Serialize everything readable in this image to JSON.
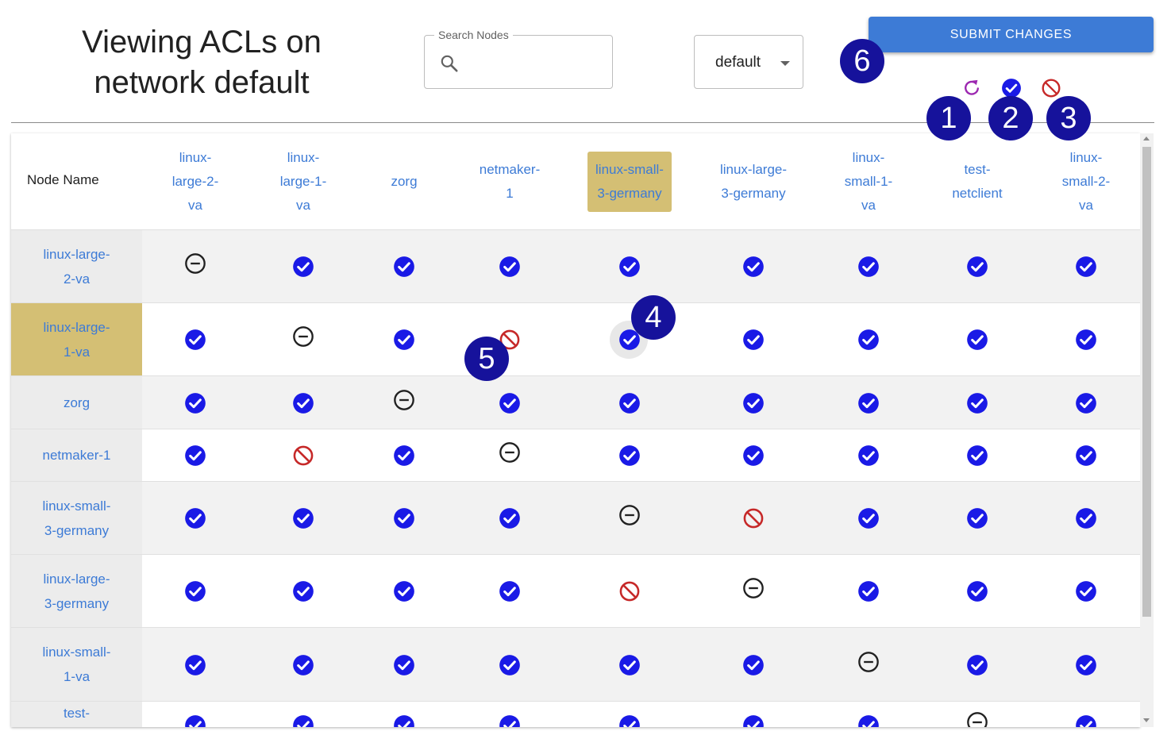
{
  "header": {
    "title_line1": "Viewing ACLs on",
    "title_line2": "network default",
    "search_label": "Search Nodes",
    "search_value": "",
    "network_select": "default",
    "submit_label": "SUBMIT CHANGES"
  },
  "legend": [
    {
      "icon": "reset-icon",
      "color": "#9c27b0"
    },
    {
      "icon": "check-circle-icon",
      "color": "#1a1ae6"
    },
    {
      "icon": "block-icon",
      "color": "#c62828"
    }
  ],
  "table": {
    "node_name_header": "Node Name",
    "columns": [
      "linux-\nlarge-2-\nva",
      "linux-\nlarge-1-\nva",
      "zorg",
      "netmaker-\n1",
      "linux-small-\n3-germany",
      "linux-large-\n3-germany",
      "linux-\nsmall-1-\nva",
      "test-\nnetclient",
      "linux-\nsmall-2-\nva"
    ],
    "highlighted_column": 4,
    "rows": [
      {
        "name": "linux-large-\n2-va",
        "cells": [
          "self",
          "allow",
          "allow",
          "allow",
          "allow",
          "allow",
          "allow",
          "allow",
          "allow"
        ]
      },
      {
        "name": "linux-large-\n1-va",
        "cells": [
          "allow",
          "self",
          "allow",
          "deny",
          "allow",
          "allow",
          "allow",
          "allow",
          "allow"
        ],
        "selected": true
      },
      {
        "name": "zorg",
        "cells": [
          "allow",
          "allow",
          "self",
          "allow",
          "allow",
          "allow",
          "allow",
          "allow",
          "allow"
        ]
      },
      {
        "name": "netmaker-1",
        "cells": [
          "allow",
          "deny",
          "allow",
          "self",
          "allow",
          "allow",
          "allow",
          "allow",
          "allow"
        ]
      },
      {
        "name": "linux-small-\n3-germany",
        "cells": [
          "allow",
          "allow",
          "allow",
          "allow",
          "self",
          "deny",
          "allow",
          "allow",
          "allow"
        ]
      },
      {
        "name": "linux-large-\n3-germany",
        "cells": [
          "allow",
          "allow",
          "allow",
          "allow",
          "deny",
          "self",
          "allow",
          "allow",
          "allow"
        ]
      },
      {
        "name": "linux-small-\n1-va",
        "cells": [
          "allow",
          "allow",
          "allow",
          "allow",
          "allow",
          "allow",
          "self",
          "allow",
          "allow"
        ]
      },
      {
        "name": "test-\nnetclient",
        "cells": [
          "allow",
          "allow",
          "allow",
          "allow",
          "allow",
          "allow",
          "allow",
          "self",
          "allow"
        ]
      }
    ]
  },
  "colors": {
    "allow": "#1a1ae6",
    "deny": "#c62828",
    "self": "#212121",
    "accent": "#3d7bd6",
    "highlight": "#d4bf74",
    "badge": "#16129b"
  },
  "badges": [
    "1",
    "2",
    "3",
    "4",
    "5",
    "6"
  ]
}
